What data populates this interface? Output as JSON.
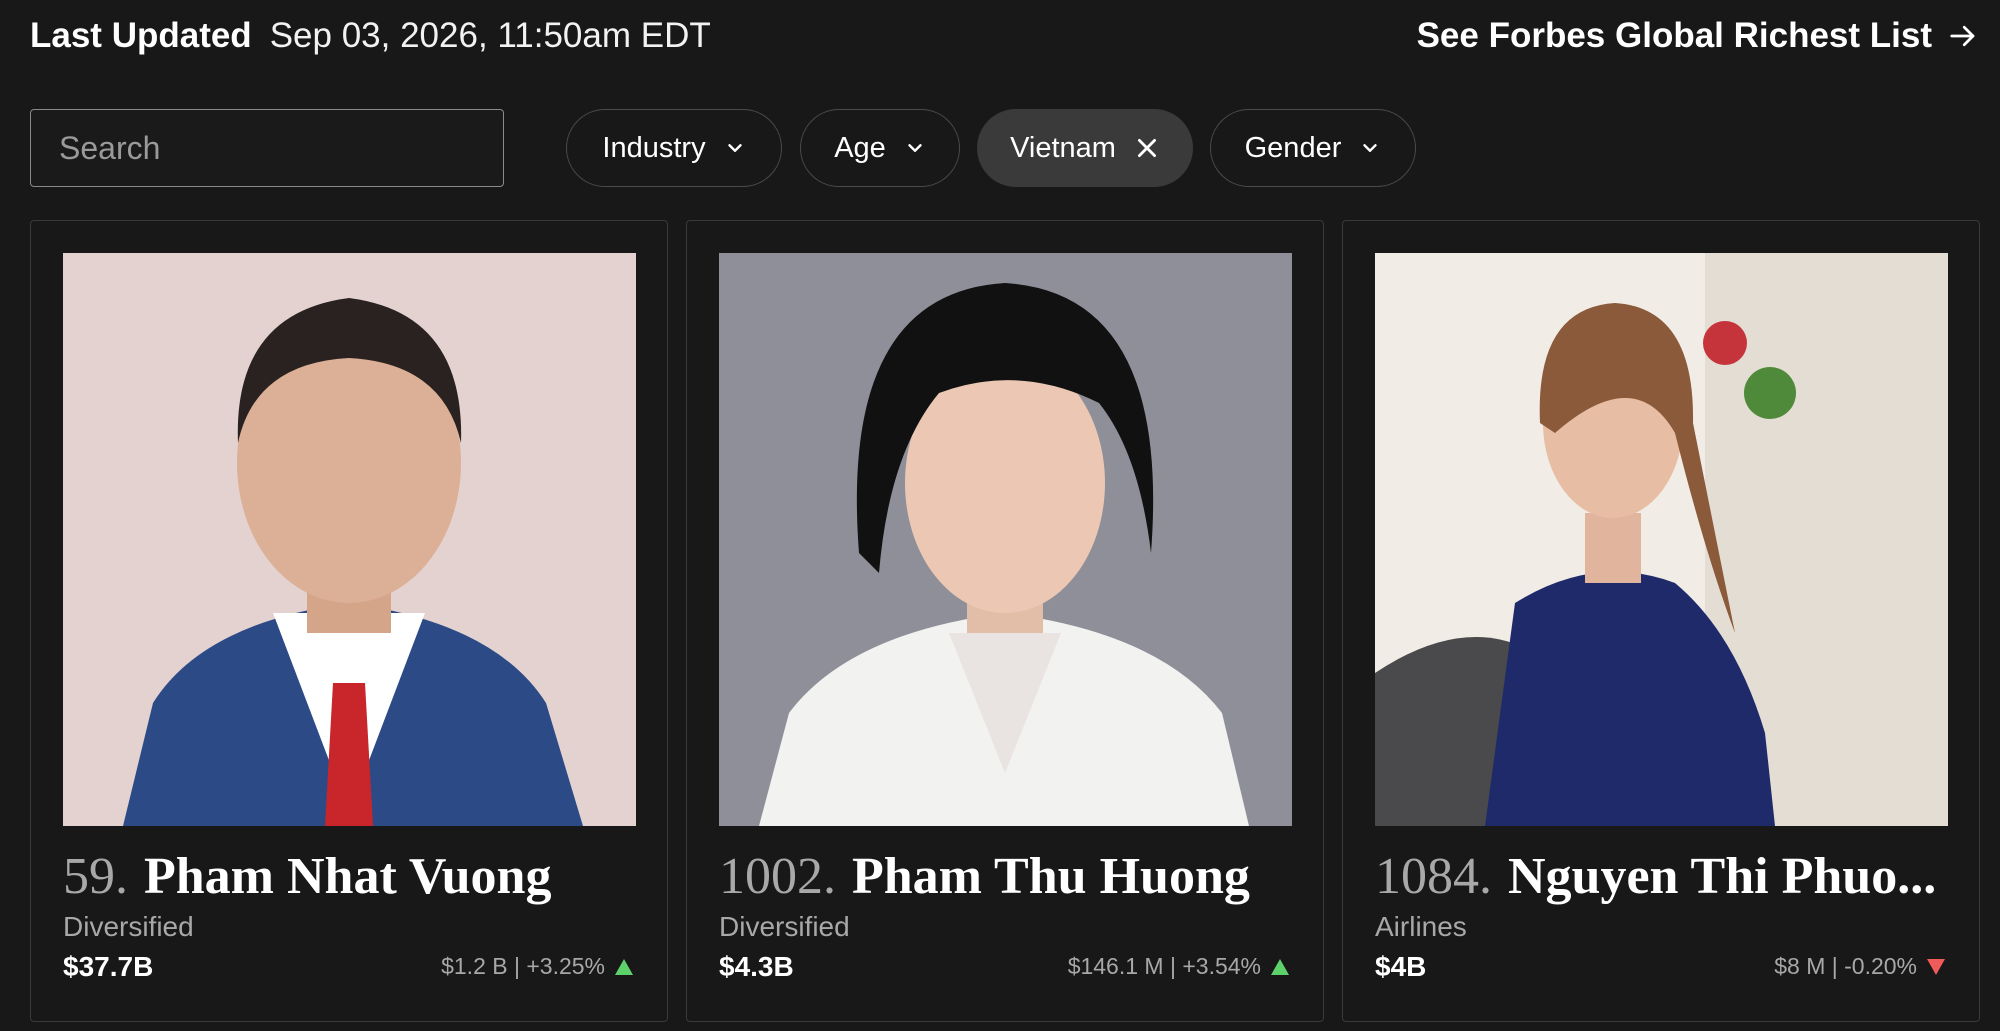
{
  "header": {
    "last_updated_label": "Last Updated",
    "last_updated_value": "Sep 03, 2026, 11:50am EDT",
    "global_link_label": "See Forbes Global Richest List",
    "global_link_icon": "arrow-right-icon"
  },
  "filters": {
    "search_placeholder": "Search",
    "search_value": "",
    "industry_label": "Industry",
    "age_label": "Age",
    "country_label": "Vietnam",
    "gender_label": "Gender"
  },
  "colors": {
    "background": "#181818",
    "active_pill": "#3a3a3a",
    "up": "#5fd16b",
    "down": "#ef5b5b"
  },
  "cards": [
    {
      "rank": "59.",
      "name": "Pham Nhat Vuong",
      "industry": "Diversified",
      "net_worth": "$37.7B",
      "change": "$1.2 B | +3.25%",
      "direction": "up"
    },
    {
      "rank": "1002.",
      "name": "Pham Thu Huong",
      "industry": "Diversified",
      "net_worth": "$4.3B",
      "change": "$146.1 M | +3.54%",
      "direction": "up"
    },
    {
      "rank": "1084.",
      "name": "Nguyen Thi Phuo...",
      "industry": "Airlines",
      "net_worth": "$4B",
      "change": "$8 M | -0.20%",
      "direction": "down"
    }
  ]
}
